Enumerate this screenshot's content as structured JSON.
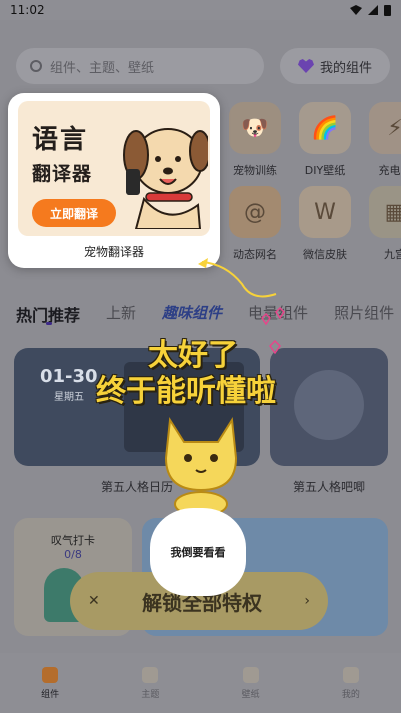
{
  "status": {
    "time": "11:02"
  },
  "search": {
    "placeholder": "组件、主题、壁纸"
  },
  "my_widgets": {
    "label": "我的组件"
  },
  "grid": [
    {
      "label": "宠物训练",
      "icon": "dog-icon"
    },
    {
      "label": "DIY壁纸",
      "icon": "rainbow-icon"
    },
    {
      "label": "充电动",
      "icon": "charge-icon"
    },
    {
      "label": "动态网名",
      "icon": "at-icon"
    },
    {
      "label": "微信皮肤",
      "icon": "w-icon"
    },
    {
      "label": "九宫",
      "icon": "grid-icon"
    }
  ],
  "tabs": [
    "热门推荐",
    "上新",
    "趣味组件",
    "电量组件",
    "照片组件"
  ],
  "cards": [
    {
      "caption": "第五人格日历",
      "clock_time": "01-30",
      "weekday": "星期五"
    },
    {
      "caption": "第五人格吧唧"
    }
  ],
  "checkin": {
    "title": "叹气打卡",
    "count": "0/8"
  },
  "promo": {
    "text": "解锁全部特权"
  },
  "nav": [
    {
      "label": "组件",
      "icon": "widget-icon"
    },
    {
      "label": "主题",
      "icon": "theme-icon"
    },
    {
      "label": "壁纸",
      "icon": "wallpaper-icon"
    },
    {
      "label": "我的",
      "icon": "profile-icon"
    }
  ],
  "highlight": {
    "title": "语言",
    "subtitle": "翻译器",
    "button": "立即翻译",
    "caption": "宠物翻译器"
  },
  "overlay": {
    "line1": "太好了",
    "line2": "终于能听懂啦",
    "bubble": "我倒要看看"
  },
  "colors": {
    "accent": "#f57a1e",
    "overlay_text": "#f7d23a",
    "tab_active": "#3d2a88"
  }
}
